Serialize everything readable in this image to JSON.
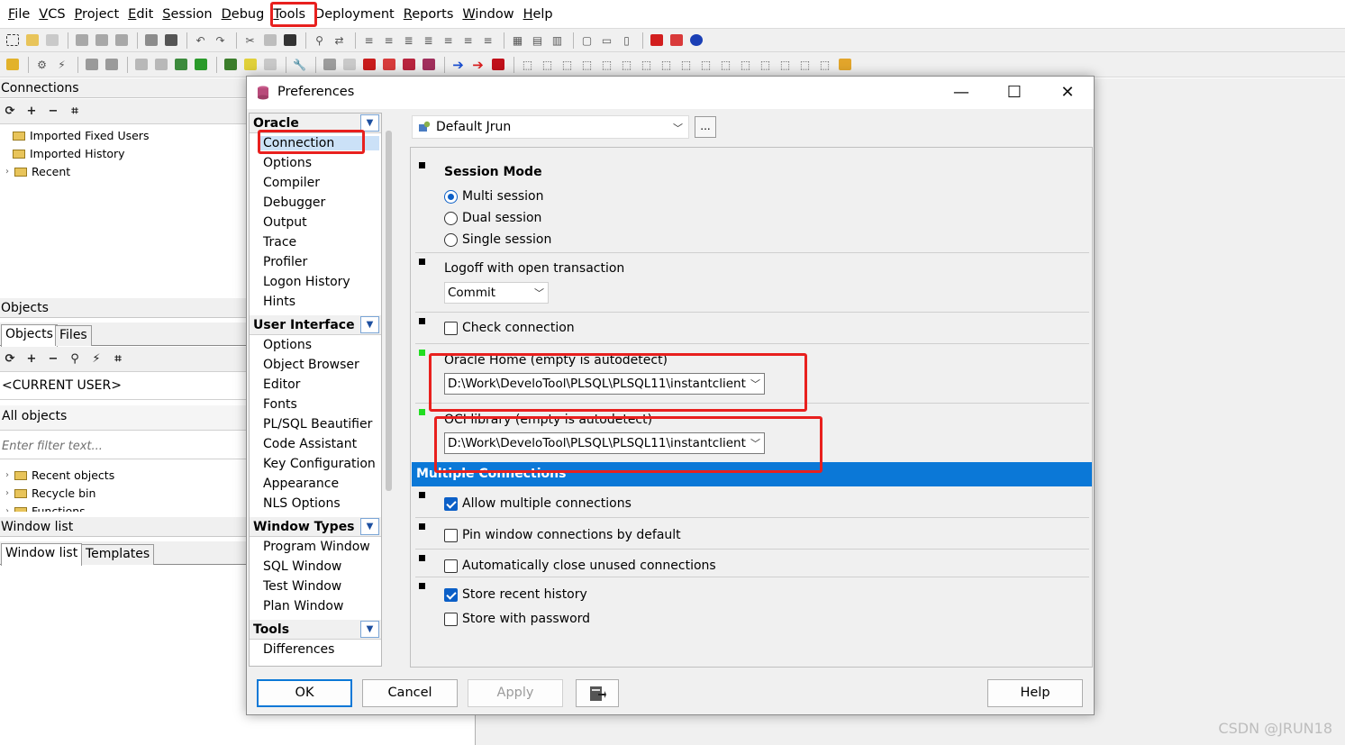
{
  "menubar": {
    "items": [
      {
        "label": "File",
        "ul": "F",
        "rest": "ile"
      },
      {
        "label": "VCS",
        "ul": "V",
        "rest": "CS"
      },
      {
        "label": "Project",
        "ul": "P",
        "rest": "roject"
      },
      {
        "label": "Edit",
        "ul": "E",
        "rest": "dit"
      },
      {
        "label": "Session",
        "ul": "S",
        "rest": "ession"
      },
      {
        "label": "Debug",
        "ul": "D",
        "rest": "ebug"
      },
      {
        "label": "Tools",
        "ul": "T",
        "rest": "ools"
      },
      {
        "label": "Deployment",
        "ul": "",
        "rest": "Deployment"
      },
      {
        "label": "Reports",
        "ul": "R",
        "rest": "eports"
      },
      {
        "label": "Window",
        "ul": "W",
        "rest": "indow"
      },
      {
        "label": "Help",
        "ul": "H",
        "rest": "elp"
      }
    ]
  },
  "left": {
    "connections": {
      "title": "Connections",
      "items": [
        "Imported Fixed Users",
        "Imported History",
        "Recent"
      ]
    },
    "objects": {
      "title": "Objects",
      "tabs": [
        "Objects",
        "Files"
      ],
      "current_user": "<CURRENT USER>",
      "scope": "All objects",
      "filter_placeholder": "Enter filter text...",
      "items": [
        "Recent objects",
        "Recycle bin",
        "Functions"
      ]
    },
    "window_list": {
      "title": "Window list",
      "tabs": [
        "Window list",
        "Templates"
      ]
    }
  },
  "dialog": {
    "title": "Preferences",
    "categories": {
      "oracle": {
        "title": "Oracle",
        "items": [
          "Connection",
          "Options",
          "Compiler",
          "Debugger",
          "Output",
          "Trace",
          "Profiler",
          "Logon History",
          "Hints"
        ]
      },
      "user_interface": {
        "title": "User Interface",
        "items": [
          "Options",
          "Object Browser",
          "Editor",
          "Fonts",
          "PL/SQL Beautifier",
          "Code Assistant",
          "Key Configuration",
          "Appearance",
          "NLS Options"
        ]
      },
      "window_types": {
        "title": "Window Types",
        "items": [
          "Program Window",
          "SQL Window",
          "Test Window",
          "Plan Window"
        ]
      },
      "tools": {
        "title": "Tools",
        "items": [
          "Differences"
        ]
      }
    },
    "profile": "Default Jrun",
    "profile_more": "...",
    "session_mode": {
      "title": "Session Mode",
      "options": [
        "Multi session",
        "Dual session",
        "Single session"
      ],
      "selected": "Multi session"
    },
    "logoff": {
      "label": "Logoff with open transaction",
      "value": "Commit"
    },
    "check_connection": {
      "label": "Check connection",
      "checked": false
    },
    "oracle_home": {
      "label": "Oracle Home (empty is autodetect)",
      "value": "D:\\Work\\DeveloTool\\PLSQL\\PLSQL11\\instantclient"
    },
    "oci_library": {
      "label": "OCI library (empty is autodetect)",
      "value": "D:\\Work\\DeveloTool\\PLSQL\\PLSQL11\\instantclient"
    },
    "multiple_connections": {
      "title": "Multiple Connections",
      "allow_multiple": {
        "label": "Allow multiple connections",
        "checked": true
      },
      "pin_window": {
        "label": "Pin window connections by default",
        "checked": false
      },
      "auto_close": {
        "label": "Automatically close unused connections",
        "checked": false
      },
      "store_history": {
        "label": "Store recent history",
        "checked": true
      },
      "store_password": {
        "label": "Store with password",
        "checked": false
      }
    },
    "buttons": {
      "ok": "OK",
      "cancel": "Cancel",
      "apply": "Apply",
      "help": "Help"
    }
  },
  "watermark": "CSDN @JRUN18",
  "colors": {
    "accent": "#0b78d7",
    "annotation": "#e8201e",
    "selection": "#cbe1f7",
    "ok_marker": "#22dd22"
  }
}
